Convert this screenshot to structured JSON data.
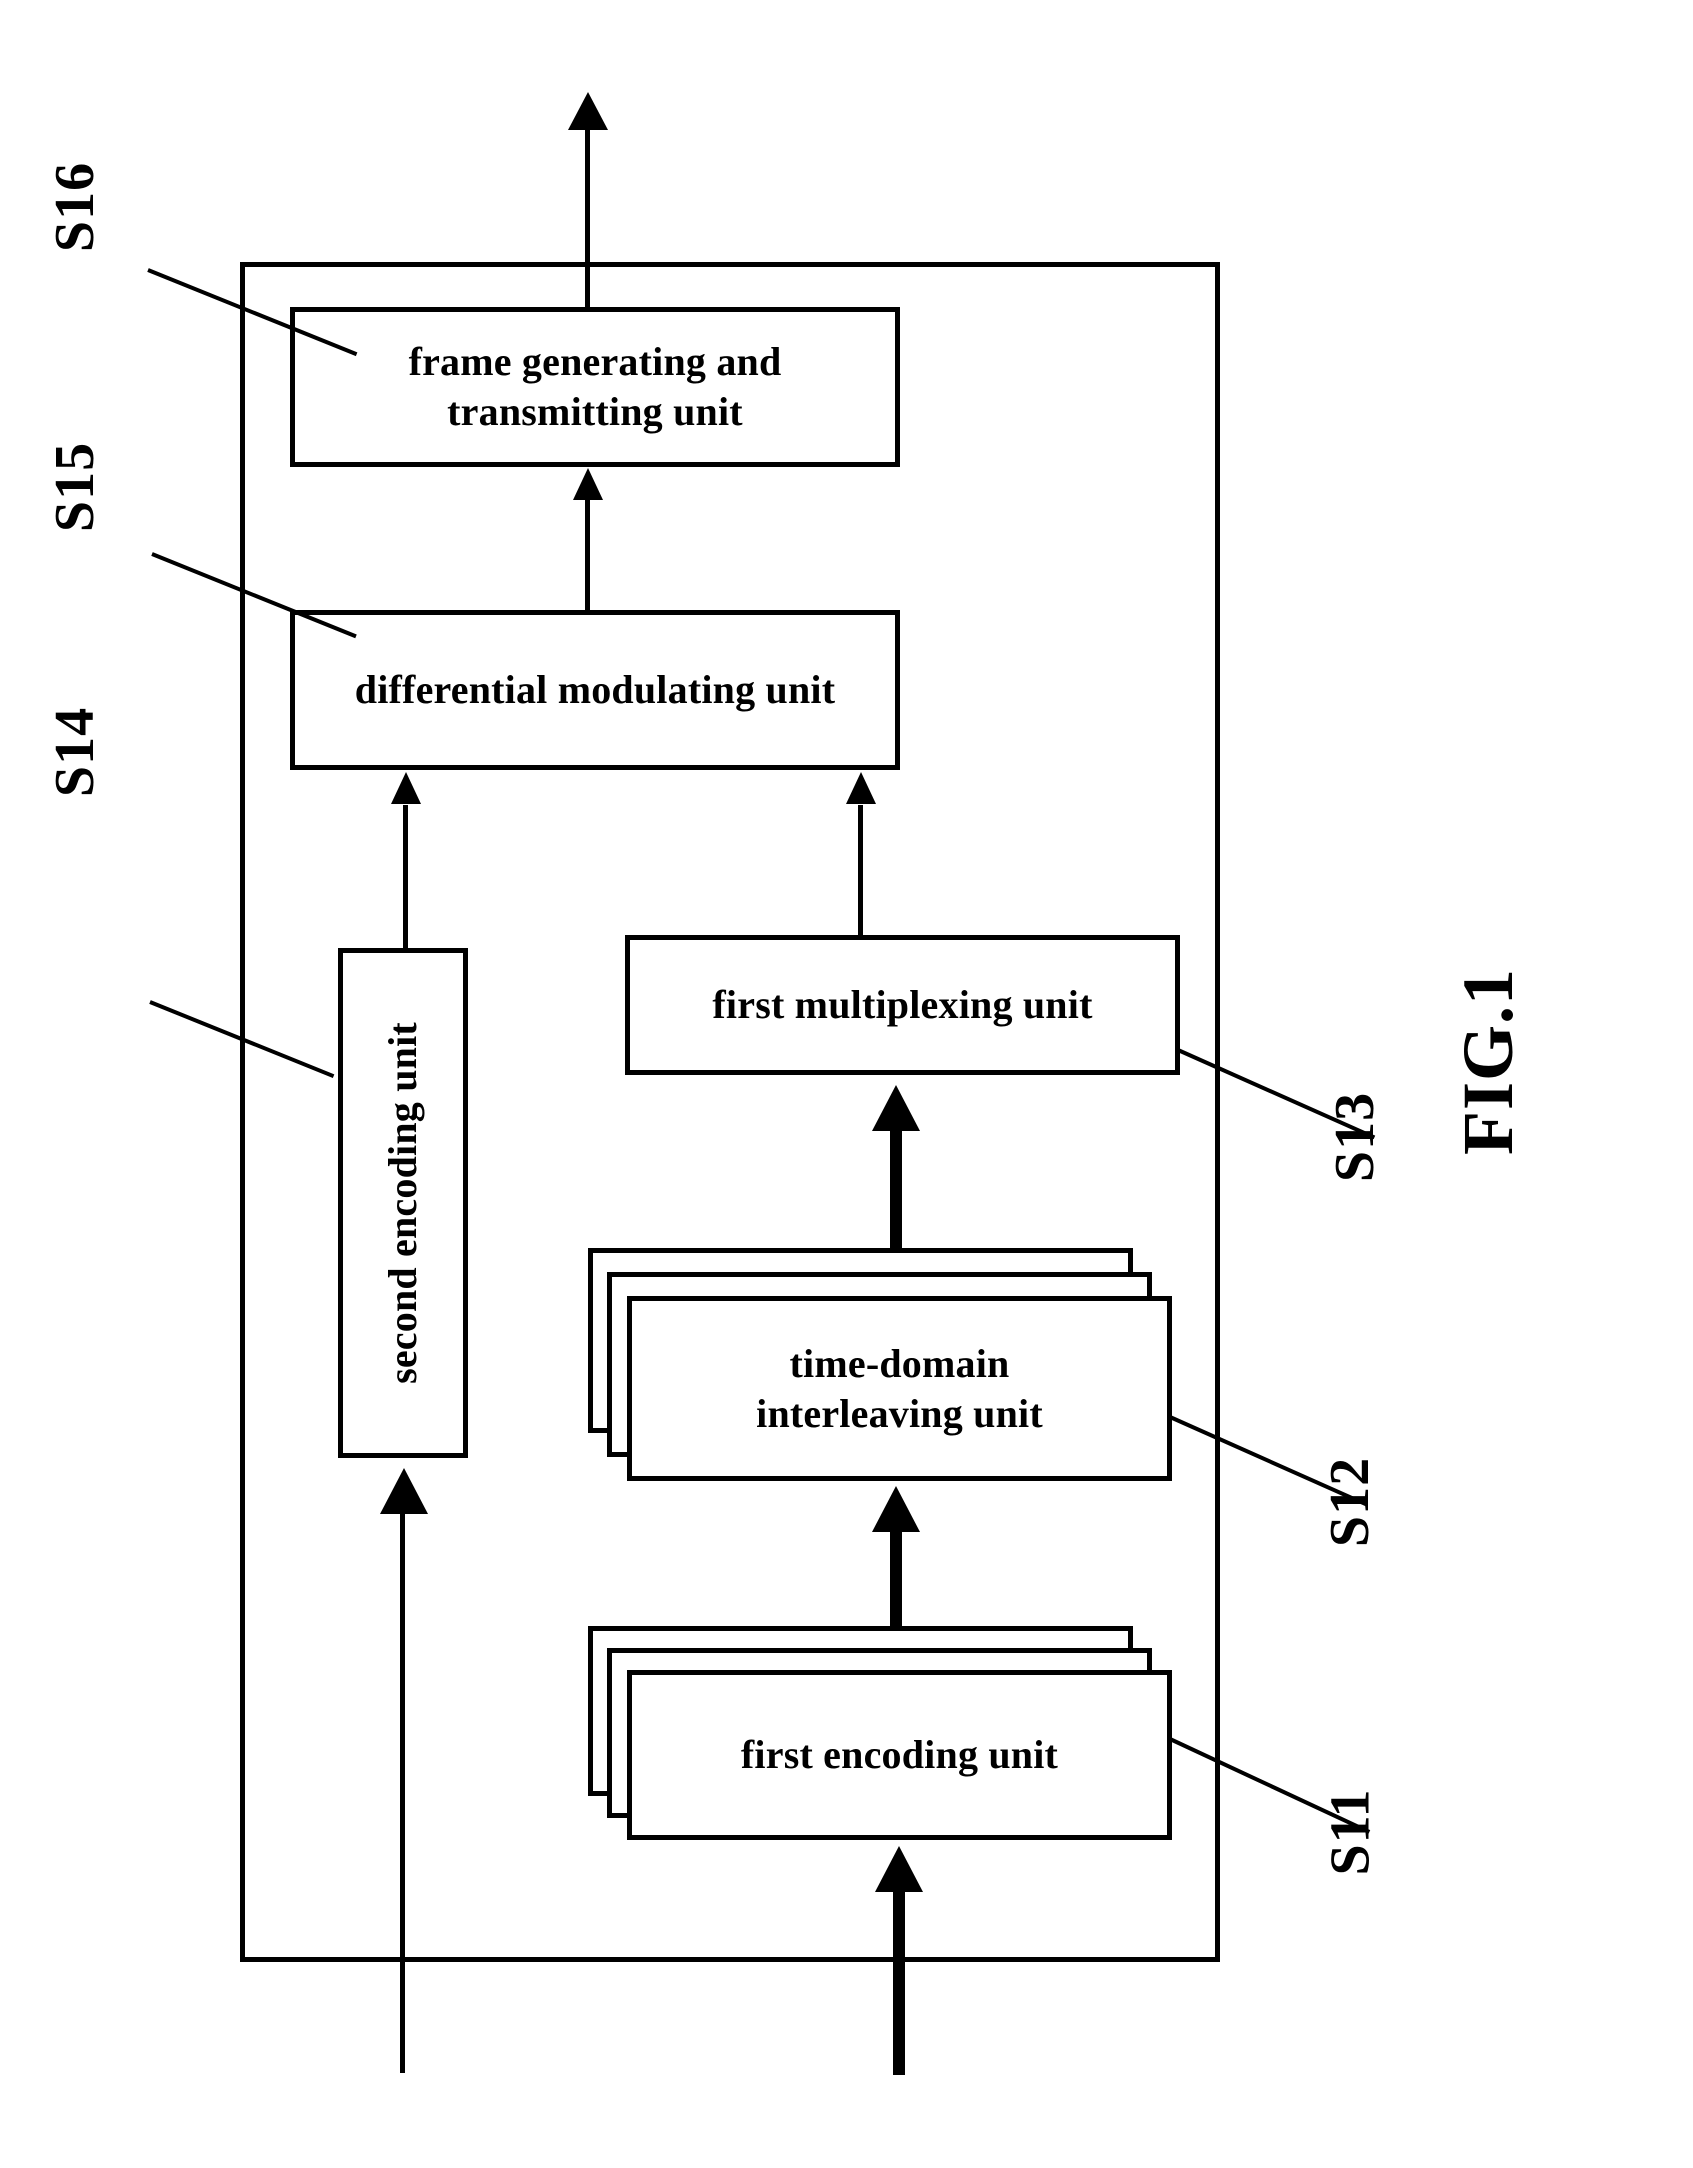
{
  "figure": {
    "caption": "FIG.1",
    "type": "patent-block-diagram",
    "orientation": "rotated-90-landscape-on-portrait-page"
  },
  "blocks": [
    {
      "id": "S16",
      "label": "frame generating and\ntransmitting unit",
      "line1": "frame generating and",
      "line2": "transmitting unit",
      "stacked": false,
      "rotated": false,
      "ref": "S16"
    },
    {
      "id": "S15",
      "label": "differential modulating unit",
      "line1": "differential modulating unit",
      "line2": "",
      "stacked": false,
      "rotated": false,
      "ref": "S15"
    },
    {
      "id": "S14",
      "label": "second encoding unit",
      "line1": "second encoding unit",
      "line2": "",
      "stacked": false,
      "rotated": true,
      "ref": "S14"
    },
    {
      "id": "S13",
      "label": "first multiplexing unit",
      "line1": "first multiplexing unit",
      "line2": "",
      "stacked": false,
      "rotated": false,
      "ref": "S13"
    },
    {
      "id": "S12",
      "label": "time-domain\ninterleaving unit",
      "line1": "time-domain",
      "line2": "interleaving unit",
      "stacked": true,
      "rotated": false,
      "ref": "S12"
    },
    {
      "id": "S11",
      "label": "first encoding unit",
      "line1": "first encoding unit",
      "line2": "",
      "stacked": true,
      "rotated": false,
      "ref": "S11"
    }
  ],
  "reference_labels": {
    "s16": "S16",
    "s15": "S15",
    "s14": "S14",
    "s13": "S13",
    "s12": "S12",
    "s11": "S11"
  },
  "caption": "FIG.1",
  "colors": {
    "stroke": "#000000",
    "background": "#ffffff"
  }
}
